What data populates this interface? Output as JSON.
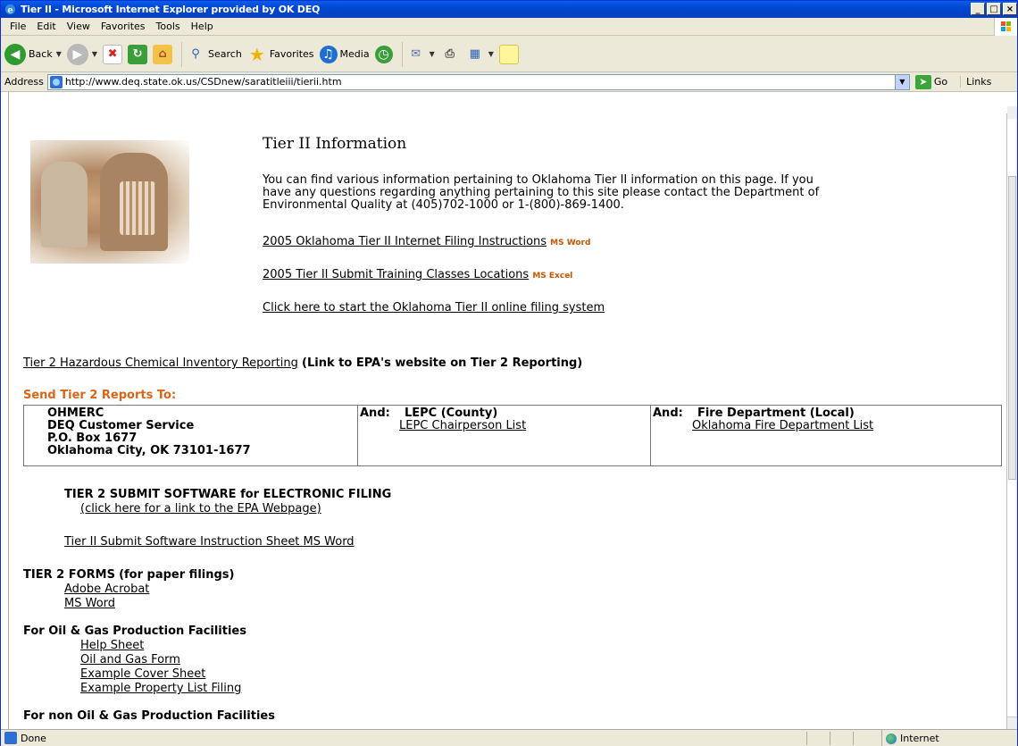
{
  "window": {
    "title": "Tier II - Microsoft Internet Explorer provided by OK DEQ",
    "controls": {
      "minimize": "_",
      "maximize": "□",
      "close": "×"
    }
  },
  "menu": [
    "File",
    "Edit",
    "View",
    "Favorites",
    "Tools",
    "Help"
  ],
  "toolbar": {
    "back": "Back",
    "search": "Search",
    "favorites": "Favorites",
    "media": "Media"
  },
  "address": {
    "label": "Address",
    "url": "http://www.deq.state.ok.us/CSDnew/saratitleiii/tierii.htm",
    "go": "Go",
    "links": "Links"
  },
  "page": {
    "title": "Tier II Information",
    "intro_lines": [
      "You can find various information pertaining to Oklahoma Tier II information on this page. If you",
      "have any questions regarding anything pertaining to this site please contact the Department of",
      "Environmental Quality at (405)702-1000 or 1-(800)-869-1400."
    ],
    "link_instructions": "2005 Oklahoma Tier II Internet Filing Instructions",
    "tag_ms_word": "MS Word",
    "link_training": "2005 Tier II Submit Training Classes Locations",
    "tag_ms_excel": "MS Excel",
    "link_online": "Click here to start the Oklahoma Tier II online filing system",
    "link_epa_tier2": "Tier 2 Hazardous Chemical Inventory Reporting",
    "epa_tier2_note": "(Link to EPA's website on Tier 2 Reporting)",
    "send_reports_heading": "Send Tier 2 Reports To:",
    "reports_table": {
      "col1": [
        "OHMERC",
        "DEQ Customer Service",
        "P.O. Box 1677",
        "Oklahoma City, OK 73101-1677"
      ],
      "and_label": "And:",
      "col2_heading": "LEPC (County)",
      "col2_link": "LEPC Chairperson List",
      "col3_heading": "Fire Department (Local)",
      "col3_link": "Oklahoma Fire Department List"
    },
    "software_heading": "TIER 2 SUBMIT SOFTWARE for ELECTRONIC FILING",
    "software_link": "(click here for a link to the EPA Webpage)",
    "instruction_sheet_link": "Tier II Submit Software Instruction Sheet MS Word",
    "forms_heading": "TIER 2 FORMS",
    "forms_note": "(for paper filings)",
    "forms_links": [
      "Adobe Acrobat",
      "MS Word"
    ],
    "oilgas_heading": "For Oil & Gas Production Facilities",
    "oilgas_links": [
      "Help Sheet",
      "Oil and Gas Form",
      "Example Cover Sheet",
      "Example Property List Filing"
    ],
    "non_oilgas_heading": "For non Oil & Gas Production Facilities"
  },
  "status": {
    "text": "Done",
    "zone": "Internet"
  },
  "colors": {
    "titlebar": "#0046d5",
    "accent_orange": "#d9651a",
    "desktop_green": "#24562a"
  }
}
